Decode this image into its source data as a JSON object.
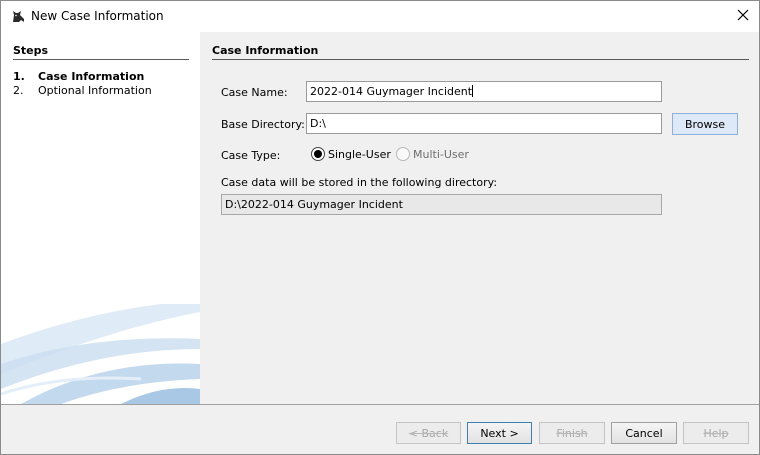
{
  "window": {
    "title": "New Case Information",
    "app_icon": "autopsy-dog-icon",
    "close_icon": "close-icon"
  },
  "steps": {
    "header": "Steps",
    "items": [
      {
        "number": "1.",
        "label": "Case Information",
        "active": true
      },
      {
        "number": "2.",
        "label": "Optional Information",
        "active": false
      }
    ]
  },
  "form": {
    "section_title": "Case Information",
    "case_name_label": "Case Name:",
    "case_name_value": "2022-014 Guymager Incident",
    "base_directory_label": "Base Directory:",
    "base_directory_value": "D:\\",
    "browse_label": "Browse",
    "case_type_label": "Case Type:",
    "case_type_options": [
      "Single-User",
      "Multi-User"
    ],
    "case_type_selected": "Single-User",
    "storage_note": "Case data will be stored in the following directory:",
    "storage_path": "D:\\2022-014 Guymager Incident"
  },
  "buttons": {
    "back": "< Back",
    "next": "Next >",
    "finish": "Finish",
    "cancel": "Cancel",
    "help": "Help"
  }
}
